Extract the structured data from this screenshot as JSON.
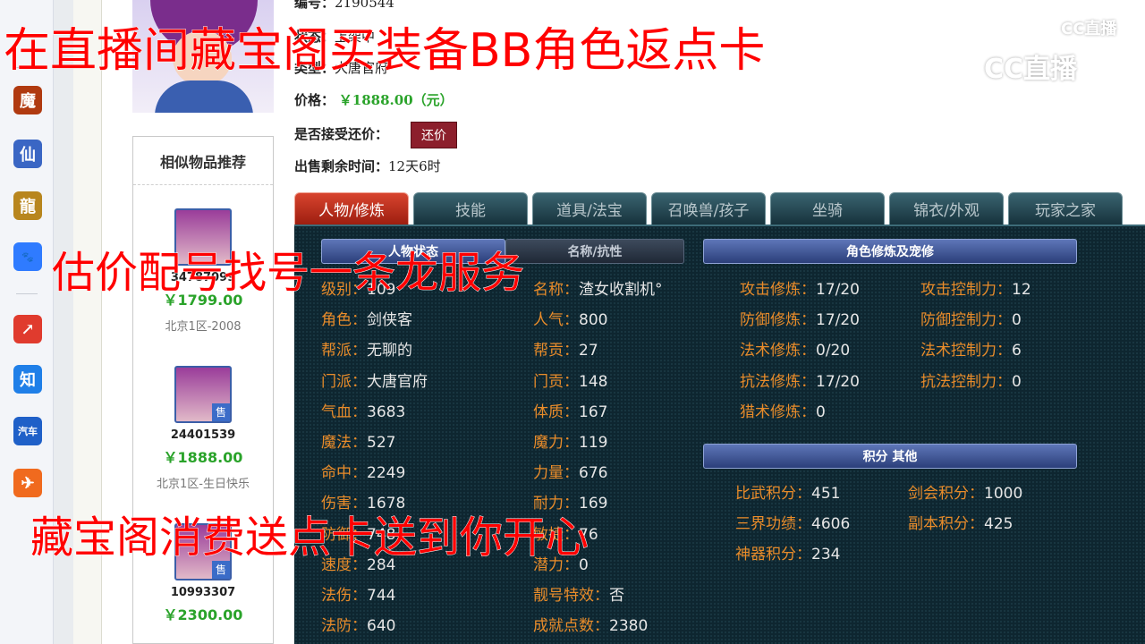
{
  "dock": {
    "icons": [
      {
        "name": "game-app-icon",
        "glyph": "魔",
        "color": "#b03a10"
      },
      {
        "name": "xian-app-icon",
        "glyph": "仙",
        "color": "#3a66c4"
      },
      {
        "name": "long-app-icon",
        "glyph": "龍",
        "color": "#b8861e"
      },
      {
        "name": "baidu-app-icon",
        "glyph": "🐾",
        "color": "#2f7bff"
      },
      {
        "name": "red-app-icon",
        "glyph": "↗",
        "color": "#e03b2e"
      },
      {
        "name": "zhihu-app-icon",
        "glyph": "知",
        "color": "#1f7fe8"
      },
      {
        "name": "car-app-icon",
        "glyph": "汽车",
        "color": "#1f60c8"
      },
      {
        "name": "orange-app-icon",
        "glyph": "✈",
        "color": "#f06a1e"
      }
    ]
  },
  "item": {
    "serial_label": "编号：",
    "serial_value": "2190544",
    "status_label": "状态：",
    "status_value": "上架中",
    "type_label": "类型：",
    "type_value": "大唐官府",
    "price_label": "价格：",
    "price_value": "￥1888.00（元）",
    "bargain_label": "是否接受还价：",
    "bargain_button": "还价",
    "remaining_label": "出售剩余时间：",
    "remaining_value": "12天6时"
  },
  "similar": {
    "title": "相似物品推荐",
    "items": [
      {
        "id": "34787099",
        "price": "￥1799.00",
        "server": "北京1区-2008",
        "badge": ""
      },
      {
        "id": "24401539",
        "price": "￥1888.00",
        "server": "北京1区-生日快乐",
        "badge": "售"
      },
      {
        "id": "10993307",
        "price": "￥2300.00",
        "server": "",
        "badge": "售"
      }
    ]
  },
  "tabs": [
    "人物/修炼",
    "技能",
    "道具/法宝",
    "召唤兽/孩子",
    "坐骑",
    "锦衣/外观",
    "玩家之家"
  ],
  "sections": {
    "char_info": "人物状态",
    "attr": "名称/抗性",
    "cultivation": "角色修炼及宠修",
    "points": "积分 其他"
  },
  "stats_col1": [
    {
      "k": "级别：",
      "v": "109"
    },
    {
      "k": "角色：",
      "v": "剑侠客"
    },
    {
      "k": "帮派：",
      "v": "无聊的"
    },
    {
      "k": "门派：",
      "v": "大唐官府"
    },
    {
      "k": "气血：",
      "v": "3683"
    },
    {
      "k": "魔法：",
      "v": "527"
    },
    {
      "k": "命中：",
      "v": "2249"
    },
    {
      "k": "伤害：",
      "v": "1678"
    },
    {
      "k": "防御：",
      "v": "748"
    },
    {
      "k": "速度：",
      "v": "284"
    },
    {
      "k": "法伤：",
      "v": "744"
    },
    {
      "k": "法防：",
      "v": "640"
    }
  ],
  "stats_col2": [
    {
      "k": "名称：",
      "v": "渣女收割机°"
    },
    {
      "k": "人气：",
      "v": "800"
    },
    {
      "k": "帮贡：",
      "v": "27"
    },
    {
      "k": "门贡：",
      "v": "148"
    },
    {
      "k": "体质：",
      "v": "167"
    },
    {
      "k": "魔力：",
      "v": "119"
    },
    {
      "k": "力量：",
      "v": "676"
    },
    {
      "k": "耐力：",
      "v": "169"
    },
    {
      "k": "敏捷：",
      "v": "76"
    },
    {
      "k": "潜力：",
      "v": "0"
    },
    {
      "k": "靓号特效：",
      "v": "否"
    },
    {
      "k": "成就点数：",
      "v": "2380"
    }
  ],
  "cultivation": [
    {
      "k": "攻击修炼：",
      "v": "17/20",
      "k2": "攻击控制力：",
      "v2": "12"
    },
    {
      "k": "防御修炼：",
      "v": "17/20",
      "k2": "防御控制力：",
      "v2": "0"
    },
    {
      "k": "法术修炼：",
      "v": "0/20",
      "k2": "法术控制力：",
      "v2": "6"
    },
    {
      "k": "抗法修炼：",
      "v": "17/20",
      "k2": "抗法控制力：",
      "v2": "0"
    },
    {
      "k": "猎术修炼：",
      "v": "0",
      "k2": "",
      "v2": ""
    }
  ],
  "points": [
    {
      "k": "比武积分：",
      "v": "451",
      "k2": "剑会积分：",
      "v2": "1000"
    },
    {
      "k": "三界功绩：",
      "v": "4606",
      "k2": "副本积分：",
      "v2": "425"
    },
    {
      "k": "神器积分：",
      "v": "234",
      "k2": "",
      "v2": ""
    }
  ],
  "watermarks": {
    "small": "CC直播",
    "large": "CC直播"
  },
  "overlay": {
    "line1": "在直播间藏宝阁买装备BB角色返点卡",
    "line2": "估价配号找号一条龙服务",
    "line3": "藏宝阁消费送点卡送到你开心"
  }
}
